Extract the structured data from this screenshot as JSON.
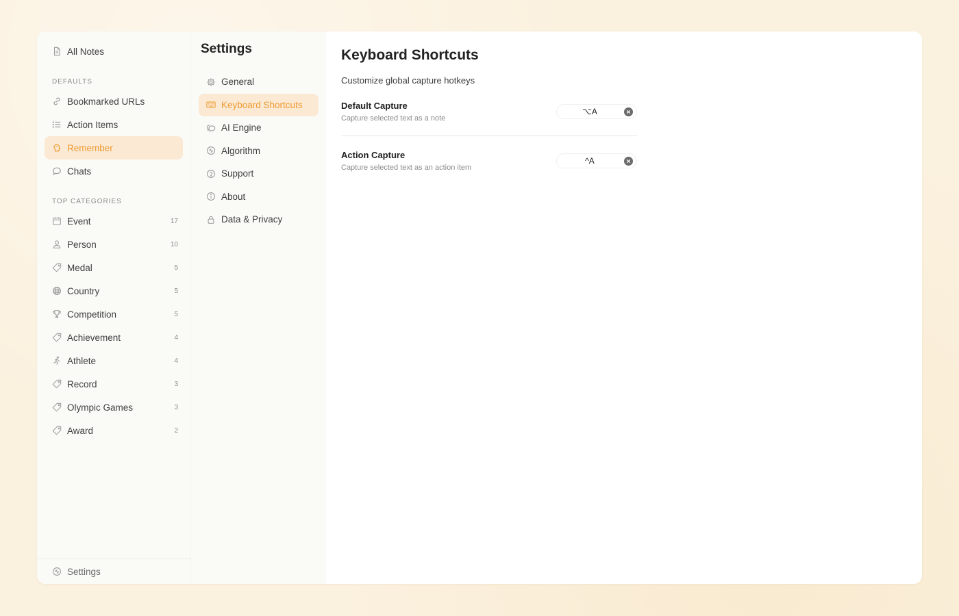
{
  "sidebar": {
    "all_notes": "All Notes",
    "defaults_title": "DEFAULTS",
    "defaults": [
      {
        "label": "Bookmarked URLs",
        "icon": "link-icon"
      },
      {
        "label": "Action Items",
        "icon": "list-icon"
      },
      {
        "label": "Remember",
        "icon": "brain-icon",
        "active": true
      },
      {
        "label": "Chats",
        "icon": "chat-bubble-icon"
      }
    ],
    "categories_title": "TOP CATEGORIES",
    "categories": [
      {
        "label": "Event",
        "count": "17",
        "icon": "calendar-icon"
      },
      {
        "label": "Person",
        "count": "10",
        "icon": "person-icon"
      },
      {
        "label": "Medal",
        "count": "5",
        "icon": "tag-icon"
      },
      {
        "label": "Country",
        "count": "5",
        "icon": "globe-icon"
      },
      {
        "label": "Competition",
        "count": "5",
        "icon": "trophy-icon"
      },
      {
        "label": "Achievement",
        "count": "4",
        "icon": "tag-icon"
      },
      {
        "label": "Athlete",
        "count": "4",
        "icon": "runner-icon"
      },
      {
        "label": "Record",
        "count": "3",
        "icon": "tag-icon"
      },
      {
        "label": "Olympic Games",
        "count": "3",
        "icon": "tag-icon"
      },
      {
        "label": "Award",
        "count": "2",
        "icon": "tag-icon"
      }
    ],
    "footer_label": "Settings"
  },
  "settings": {
    "title": "Settings",
    "items": [
      {
        "label": "General",
        "icon": "gear-icon"
      },
      {
        "label": "Keyboard Shortcuts",
        "icon": "keyboard-icon",
        "active": true
      },
      {
        "label": "AI Engine",
        "icon": "ai-icon"
      },
      {
        "label": "Algorithm",
        "icon": "algorithm-icon"
      },
      {
        "label": "Support",
        "icon": "help-icon"
      },
      {
        "label": "About",
        "icon": "info-icon"
      },
      {
        "label": "Data & Privacy",
        "icon": "lock-icon"
      }
    ]
  },
  "main": {
    "title": "Keyboard Shortcuts",
    "subtitle": "Customize global capture hotkeys",
    "shortcuts": [
      {
        "title": "Default Capture",
        "desc": "Capture selected text as a note",
        "key": "⌥A"
      },
      {
        "title": "Action Capture",
        "desc": "Capture selected text as an action item",
        "key": "^A"
      }
    ]
  },
  "colors": {
    "accent": "#ee9a2f",
    "active_bg": "#fbe9d4",
    "page_bg": "#fbf1df"
  }
}
